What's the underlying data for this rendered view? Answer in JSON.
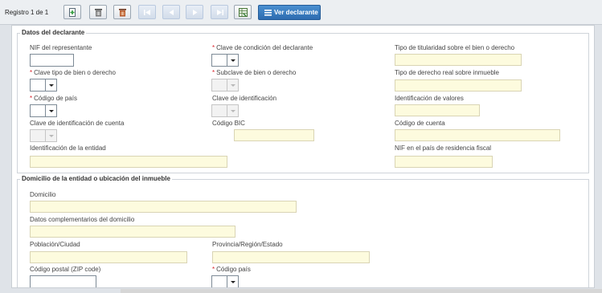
{
  "toolbar": {
    "record_label": "Registro 1 de 1",
    "ver_declarante_label": "Ver declarante"
  },
  "section_declarante": {
    "title": "Datos del declarante",
    "nif_representante": "NIF del representante",
    "clave_condicion": "Clave de condición del declarante",
    "tipo_titularidad": "Tipo de titularidad sobre el bien o derecho",
    "clave_tipo_bien": "Clave tipo de bien o derecho",
    "subclave_bien": "Subclave de bien o derecho",
    "tipo_derecho_real": "Tipo de derecho real sobre inmueble",
    "codigo_pais": "Código de país",
    "clave_identificacion": "Clave de identificación",
    "identificacion_valores": "Identificación de valores",
    "clave_identificacion_cuenta": "Clave de identificación de cuenta",
    "codigo_bic": "Código BIC",
    "codigo_cuenta": "Código de cuenta",
    "identificacion_entidad": "Identificación de la entidad",
    "nif_pais_residencia": "NIF en el país de residencia fiscal"
  },
  "section_domicilio": {
    "title": "Domicilio de la entidad o ubicación del inmueble",
    "domicilio": "Domicilio",
    "datos_complementarios": "Datos complementarios del domicilio",
    "poblacion": "Población/Ciudad",
    "provincia": "Provincia/Región/Estado",
    "codigo_postal": "Código postal (ZIP code)",
    "codigo_pais": "Código país"
  },
  "required_marker": "*",
  "colors": {
    "accent": "#2d6cb0",
    "required": "#d9232b",
    "field_bg": "#fdfbde"
  }
}
